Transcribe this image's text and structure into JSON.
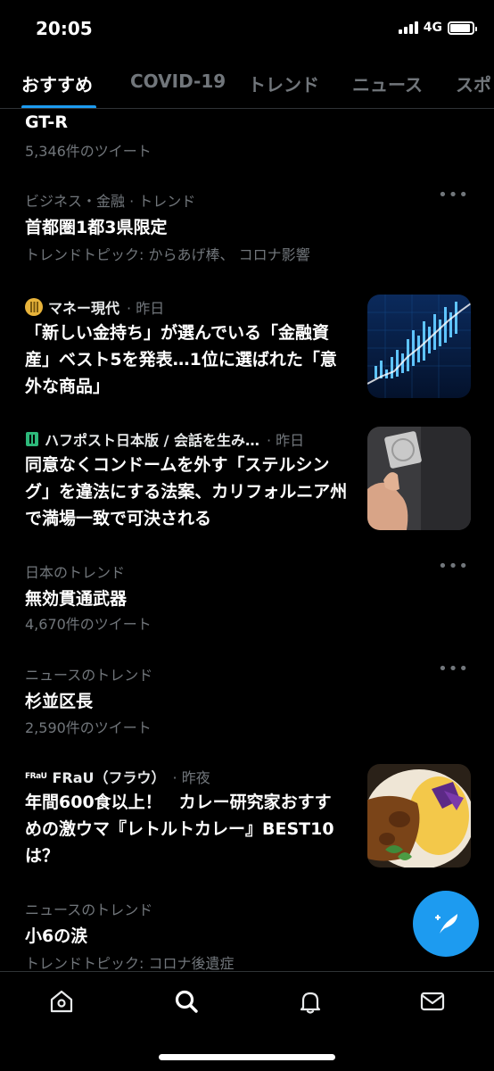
{
  "status_bar": {
    "time": "20:05",
    "network": "4G",
    "battery_level": 0.9
  },
  "tabs": [
    {
      "label": "おすすめ",
      "active": true
    },
    {
      "label": "COVID-19",
      "active": false
    },
    {
      "label": "トレンド",
      "active": false
    },
    {
      "label": "ニュース",
      "active": false
    },
    {
      "label": "スポ",
      "active": false
    }
  ],
  "feed": {
    "trend0": {
      "title": "GT-R",
      "count": "5,346件のツイート"
    },
    "trend1": {
      "category": "ビジネス・金融 · トレンド",
      "title": "首都圏1都3県限定",
      "topics": "トレンドトピック: からあげ棒、 コロナ影響"
    },
    "news1": {
      "source": "マネー現代",
      "time": "· 昨日",
      "headline": "「新しい金持ち」が選んでいる「金融資産」ベスト5を発表…1位に選ばれた「意外な商品」",
      "image": "stock-chart-image"
    },
    "news2": {
      "source": "ハフポスト日本版 / 会話を生み…",
      "time": "· 昨日",
      "headline": "同意なくコンドームを外す「ステルシング」を違法にする法案、カリフォルニア州で満場一致で可決される",
      "image": "hand-holding-condom-image"
    },
    "trend2": {
      "category": "日本のトレンド",
      "title": "無効貫通武器",
      "count": "4,670件のツイート"
    },
    "trend3": {
      "category": "ニュースのトレンド",
      "title": "杉並区長",
      "count": "2,590件のツイート"
    },
    "news3": {
      "source_logo": "FRaU",
      "source": "FRaU（フラウ）",
      "time": "· 昨夜",
      "headline": "年間600食以上！　カレー研究家おすすめの激ウマ『レトルトカレー』BEST10は？",
      "image": "curry-plate-image"
    },
    "trend4": {
      "category": "ニュースのトレンド",
      "title": "小6の涙",
      "topics": "トレンドトピック: コロナ後遺症"
    }
  },
  "more_glyph": "•••",
  "fab": {
    "icon": "compose-tweet-icon"
  },
  "bottom_nav": [
    {
      "icon": "home-icon"
    },
    {
      "icon": "search-icon",
      "active": true
    },
    {
      "icon": "notifications-icon"
    },
    {
      "icon": "messages-icon"
    }
  ],
  "colors": {
    "accent": "#1d9bf0",
    "background": "#000000",
    "text": "#e7e9ea",
    "muted": "#71767b"
  }
}
